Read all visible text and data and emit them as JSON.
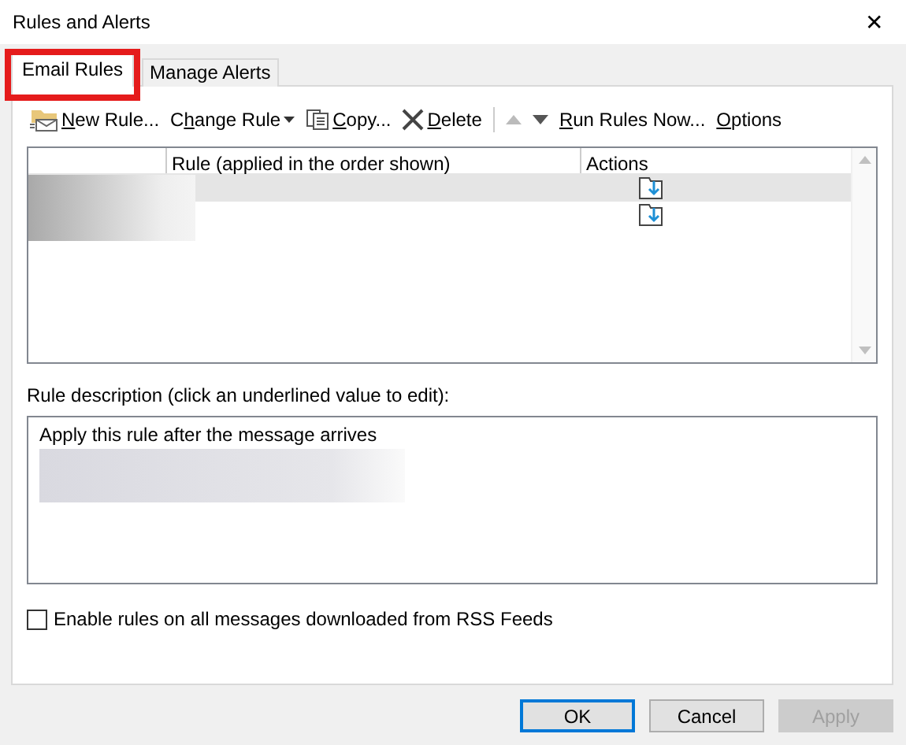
{
  "window": {
    "title": "Rules and Alerts",
    "close": "✕"
  },
  "tabs": [
    {
      "label": "Email Rules",
      "selected": true,
      "highlighted": true
    },
    {
      "label": "Manage Alerts",
      "selected": false,
      "highlighted": false
    }
  ],
  "toolbar": [
    {
      "kind": "button",
      "key": "N",
      "post": "ew Rule..."
    },
    {
      "kind": "menu",
      "pre": "C",
      "key": "h",
      "post": "ange Rule"
    },
    {
      "kind": "button",
      "key": "C",
      "post": "opy..."
    },
    {
      "kind": "button",
      "key": "D",
      "post": "elete"
    },
    {
      "kind": "separator"
    },
    {
      "kind": "arrow",
      "disabled": true
    },
    {
      "kind": "arrow",
      "disabled": false
    },
    {
      "kind": "button",
      "key": "R",
      "post": "un Rules Now..."
    },
    {
      "kind": "button",
      "key": "O",
      "post": "ptions"
    }
  ],
  "rules_table": {
    "columns": [
      "Rule (applied in the order shown)",
      "Actions"
    ],
    "rows": [
      {
        "selected": true
      },
      {
        "selected": false
      }
    ]
  },
  "description": {
    "label": "Rule description (click an underlined value to edit):",
    "text": "Apply this rule after the message arrives"
  },
  "rss_option": {
    "label": "Enable rules on all messages downloaded from RSS Feeds",
    "checked": false
  },
  "buttons": [
    {
      "label": "OK",
      "default": true,
      "disabled": false
    },
    {
      "label": "Cancel",
      "default": false,
      "disabled": false
    },
    {
      "label": "Apply",
      "default": false,
      "disabled": true
    }
  ]
}
